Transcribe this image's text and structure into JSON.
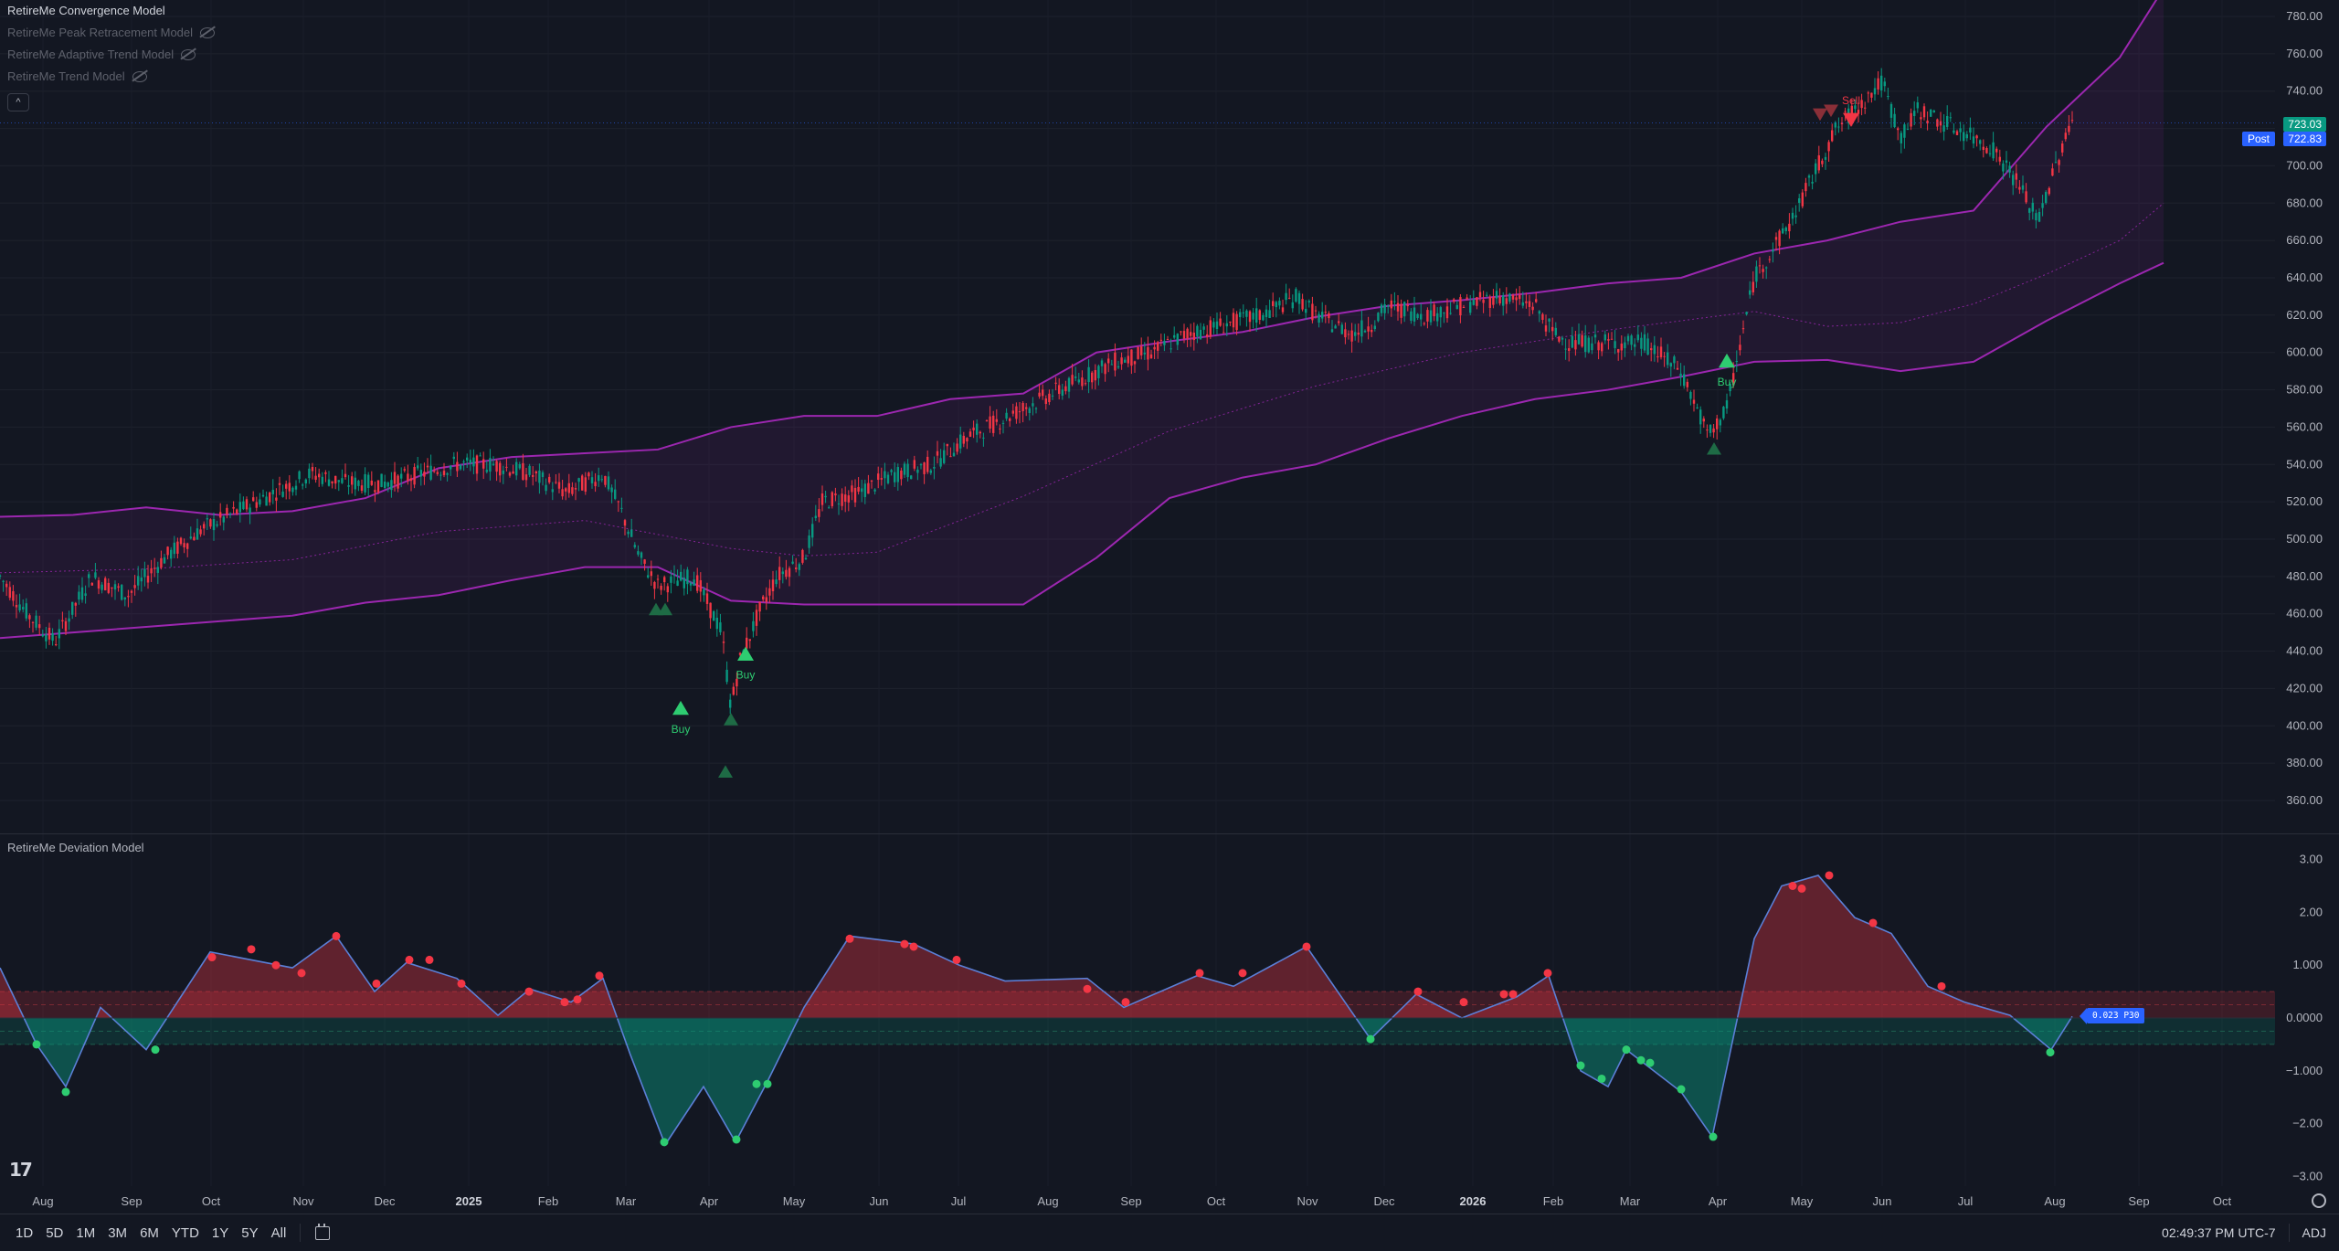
{
  "legend": {
    "main": "RetireMe Convergence Model",
    "items": [
      "RetireMe Peak Retracement Model",
      "RetireMe Adaptive Trend Model",
      "RetireMe Trend Model"
    ]
  },
  "oscillator_title": "RetireMe Deviation Model",
  "price_tags": {
    "last": "723.03",
    "post_label": "Post",
    "post_value": "722.83"
  },
  "osc_tag": "0.023  P30",
  "range_buttons": [
    "1D",
    "5D",
    "1M",
    "3M",
    "6M",
    "YTD",
    "1Y",
    "5Y",
    "All"
  ],
  "clock": "02:49:37 PM UTC-7",
  "adj": "ADJ",
  "colors": {
    "bg": "#131722",
    "up": "#089981",
    "down": "#f23645",
    "band": "#9c27b0",
    "buy": "#2ecc71",
    "sell": "#f23645"
  },
  "chart_data": [
    {
      "type": "line",
      "title": "",
      "y_ticks": [
        360,
        380,
        400,
        420,
        440,
        460,
        480,
        500,
        520,
        540,
        560,
        580,
        600,
        620,
        640,
        660,
        680,
        700,
        720,
        740,
        760,
        780
      ],
      "ylim": [
        350,
        790
      ],
      "x_labels": [
        "Aug",
        "Sep",
        "Oct",
        "Nov",
        "Dec",
        "2025",
        "Feb",
        "Mar",
        "Apr",
        "May",
        "Jun",
        "Jul",
        "Aug",
        "Sep",
        "Oct",
        "Nov",
        "Dec",
        "2026",
        "Feb",
        "Mar",
        "Apr",
        "May",
        "Jun",
        "Jul",
        "Aug",
        "Sep",
        "Oct"
      ],
      "x_bold": [
        "2025",
        "2026"
      ],
      "series": [
        {
          "values": [
            [
              0,
              512
            ],
            [
              80,
              513
            ],
            [
              160,
              517
            ],
            [
              240,
              513
            ],
            [
              320,
              515
            ],
            [
              400,
              522
            ],
            [
              480,
              538
            ],
            [
              560,
              544
            ],
            [
              640,
              546
            ],
            [
              720,
              548
            ],
            [
              800,
              560
            ],
            [
              880,
              566
            ],
            [
              960,
              566
            ],
            [
              1040,
              575
            ],
            [
              1120,
              578
            ],
            [
              1200,
              600
            ],
            [
              1280,
              606
            ],
            [
              1360,
              611
            ],
            [
              1440,
              619
            ],
            [
              1520,
              625
            ],
            [
              1600,
              628
            ],
            [
              1680,
              632
            ],
            [
              1760,
              637
            ],
            [
              1840,
              640
            ],
            [
              1920,
              653
            ],
            [
              2000,
              660
            ],
            [
              2080,
              670
            ],
            [
              2160,
              676
            ],
            [
              2240,
              721
            ],
            [
              2320,
              758
            ],
            [
              2368,
              795
            ]
          ]
        },
        {
          "values": [
            [
              0,
              447
            ],
            [
              80,
              450
            ],
            [
              160,
              453
            ],
            [
              240,
              456
            ],
            [
              320,
              459
            ],
            [
              400,
              466
            ],
            [
              480,
              470
            ],
            [
              560,
              478
            ],
            [
              640,
              485
            ],
            [
              720,
              485
            ],
            [
              800,
              467
            ],
            [
              880,
              465
            ],
            [
              960,
              465
            ],
            [
              1040,
              465
            ],
            [
              1120,
              465
            ],
            [
              1200,
              490
            ],
            [
              1280,
              522
            ],
            [
              1360,
              533
            ],
            [
              1440,
              540
            ],
            [
              1520,
              554
            ],
            [
              1600,
              566
            ],
            [
              1680,
              575
            ],
            [
              1760,
              580
            ],
            [
              1840,
              587
            ],
            [
              1920,
              595
            ],
            [
              2000,
              596
            ],
            [
              2080,
              590
            ],
            [
              2160,
              595
            ],
            [
              2240,
              617
            ],
            [
              2320,
              637
            ],
            [
              2368,
              648
            ]
          ]
        },
        {
          "values": [
            [
              0,
              482
            ],
            [
              160,
              484
            ],
            [
              320,
              489
            ],
            [
              480,
              504
            ],
            [
              640,
              510
            ],
            [
              800,
              495
            ],
            [
              880,
              491
            ],
            [
              960,
              493
            ],
            [
              1120,
              523
            ],
            [
              1280,
              558
            ],
            [
              1440,
              582
            ],
            [
              1600,
              600
            ],
            [
              1760,
              612
            ],
            [
              1920,
              622
            ],
            [
              2000,
              614
            ],
            [
              2080,
              616
            ],
            [
              2160,
              626
            ],
            [
              2240,
              642
            ],
            [
              2320,
              660
            ],
            [
              2368,
              680
            ]
          ]
        }
      ]
    },
    {
      "type": "area",
      "title": "",
      "y_ticks": [
        -3,
        -2,
        -1,
        0,
        1,
        2,
        3
      ],
      "y_tick_labels": [
        "−3.00",
        "−2.00",
        "−1.000",
        "0.0000",
        "1.000",
        "2.00",
        "3.00"
      ],
      "ylim": [
        -3.1,
        3.3
      ],
      "series": [
        {
          "values": [
            [
              0,
              0.95
            ],
            [
              40,
              -0.5
            ],
            [
              72,
              -1.3
            ],
            [
              110,
              0.2
            ],
            [
              160,
              -0.6
            ],
            [
              230,
              1.25
            ],
            [
              275,
              1.1
            ],
            [
              320,
              0.95
            ],
            [
              368,
              1.55
            ],
            [
              410,
              0.5
            ],
            [
              445,
              1.05
            ],
            [
              500,
              0.75
            ],
            [
              545,
              0.05
            ],
            [
              580,
              0.55
            ],
            [
              625,
              0.3
            ],
            [
              660,
              0.75
            ],
            [
              690,
              -0.7
            ],
            [
              728,
              -2.4
            ],
            [
              770,
              -1.3
            ],
            [
              805,
              -2.35
            ],
            [
              840,
              -1.2
            ],
            [
              880,
              0.2
            ],
            [
              930,
              1.55
            ],
            [
              1000,
              1.4
            ],
            [
              1050,
              1.0
            ],
            [
              1100,
              0.7
            ],
            [
              1190,
              0.75
            ],
            [
              1230,
              0.2
            ],
            [
              1310,
              0.8
            ],
            [
              1350,
              0.6
            ],
            [
              1430,
              1.35
            ],
            [
              1500,
              -0.4
            ],
            [
              1550,
              0.45
            ],
            [
              1600,
              0.0
            ],
            [
              1660,
              0.4
            ],
            [
              1695,
              0.8
            ],
            [
              1730,
              -1.0
            ],
            [
              1760,
              -1.3
            ],
            [
              1780,
              -0.6
            ],
            [
              1840,
              -1.4
            ],
            [
              1874,
              -2.25
            ],
            [
              1920,
              1.5
            ],
            [
              1950,
              2.5
            ],
            [
              1990,
              2.7
            ],
            [
              2030,
              1.9
            ],
            [
              2070,
              1.6
            ],
            [
              2110,
              0.6
            ],
            [
              2150,
              0.3
            ],
            [
              2200,
              0.05
            ],
            [
              2245,
              -0.6
            ],
            [
              2268,
              0.03
            ]
          ]
        }
      ],
      "bands": {
        "upper": [
          0,
          0.5
        ],
        "lower": [
          -0.5,
          0
        ]
      },
      "sell_dots": [
        [
          232,
          1.15
        ],
        [
          275,
          1.3
        ],
        [
          302,
          1.0
        ],
        [
          330,
          0.85
        ],
        [
          368,
          1.55
        ],
        [
          412,
          0.65
        ],
        [
          448,
          1.1
        ],
        [
          470,
          1.1
        ],
        [
          505,
          0.65
        ],
        [
          579,
          0.5
        ],
        [
          618,
          0.3
        ],
        [
          632,
          0.35
        ],
        [
          656,
          0.8
        ],
        [
          930,
          1.5
        ],
        [
          990,
          1.4
        ],
        [
          1000,
          1.35
        ],
        [
          1047,
          1.1
        ],
        [
          1190,
          0.55
        ],
        [
          1232,
          0.3
        ],
        [
          1313,
          0.85
        ],
        [
          1360,
          0.85
        ],
        [
          1430,
          1.35
        ],
        [
          1552,
          0.5
        ],
        [
          1602,
          0.3
        ],
        [
          1646,
          0.45
        ],
        [
          1656,
          0.45
        ],
        [
          1694,
          0.85
        ],
        [
          1962,
          2.5
        ],
        [
          1972,
          2.45
        ],
        [
          2002,
          2.7
        ],
        [
          2050,
          1.8
        ],
        [
          2125,
          0.6
        ]
      ],
      "buy_dots": [
        [
          40,
          -0.5
        ],
        [
          72,
          -1.4
        ],
        [
          170,
          -0.6
        ],
        [
          727,
          -2.35
        ],
        [
          806,
          -2.3
        ],
        [
          828,
          -1.25
        ],
        [
          840,
          -1.25
        ],
        [
          1500,
          -0.4
        ],
        [
          1730,
          -0.9
        ],
        [
          1753,
          -1.15
        ],
        [
          1780,
          -0.6
        ],
        [
          1796,
          -0.8
        ],
        [
          1806,
          -0.85
        ],
        [
          1840,
          -1.35
        ],
        [
          1875,
          -2.25
        ],
        [
          2244,
          -0.65
        ]
      ]
    }
  ],
  "signals": {
    "buy_label": "Buy",
    "sell_label": "Sell",
    "buy": [
      [
        745,
        409,
        "Buy"
      ],
      [
        816,
        438,
        "Buy"
      ],
      [
        1890,
        595,
        "Buy"
      ]
    ],
    "buy_faint": [
      [
        718,
        462
      ],
      [
        728,
        462
      ],
      [
        800,
        403
      ],
      [
        794,
        375
      ],
      [
        1876,
        548
      ]
    ],
    "sell": [
      [
        2026,
        735,
        "Sell"
      ]
    ],
    "sell_faint": [
      [
        2004,
        730
      ],
      [
        1992,
        728
      ]
    ]
  }
}
